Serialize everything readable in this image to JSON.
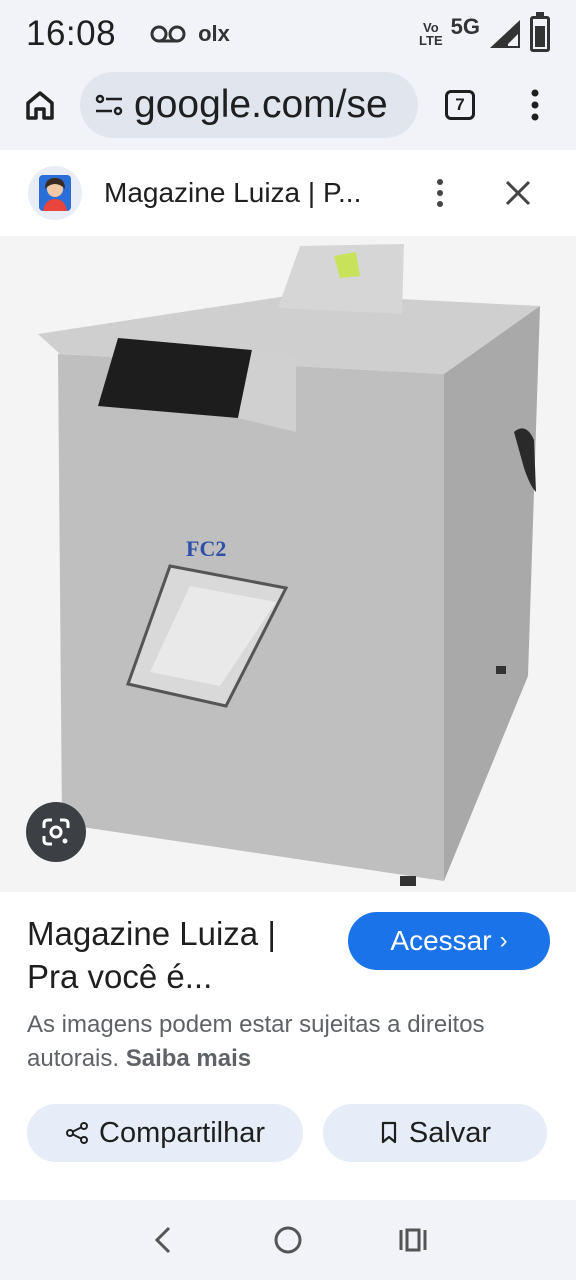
{
  "status": {
    "time": "16:08",
    "left_icons": [
      "voicemail-icon",
      "olx-app-icon"
    ],
    "olx_label": "olx",
    "volte_top": "Vo",
    "volte_bottom": "LTE",
    "network": "5G",
    "battery_level": 0.7
  },
  "browser": {
    "url": "google.com/se",
    "tab_count": "7"
  },
  "sheet": {
    "source_title": "Magazine Luiza | P...",
    "image_label": "FC2",
    "result_title_line1": "Magazine Luiza |",
    "result_title_line2": "Pra você é...",
    "visit_label": "Acessar",
    "copyright_text": "As imagens podem estar sujeitas a direitos autorais.",
    "learn_more": "Saiba mais",
    "share_label": "Compartilhar",
    "save_label": "Salvar"
  },
  "colors": {
    "accent": "#1a73e8",
    "pill_bg": "#e6ecf8",
    "url_bg": "#e1e5ee"
  }
}
